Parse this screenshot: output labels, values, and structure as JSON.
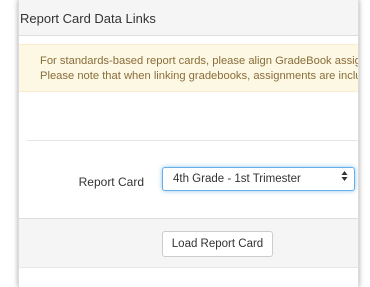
{
  "panel": {
    "title": "Report Card Data Links"
  },
  "alert": {
    "line1": "For standards-based report cards, please align GradeBook assignments",
    "line2": "Please note that when linking gradebooks, assignments are included"
  },
  "form": {
    "report_card_label": "Report Card",
    "report_card_value": "4th Grade - 1st Trimester"
  },
  "footer": {
    "load_button_label": "Load Report Card"
  },
  "icons": {
    "select_caret": "updown-caret-icon"
  },
  "colors": {
    "alert_bg": "#fcf8e3",
    "alert_text": "#8a6d3b",
    "focus_border": "#66afe9",
    "heading_bg": "#f5f5f5"
  }
}
